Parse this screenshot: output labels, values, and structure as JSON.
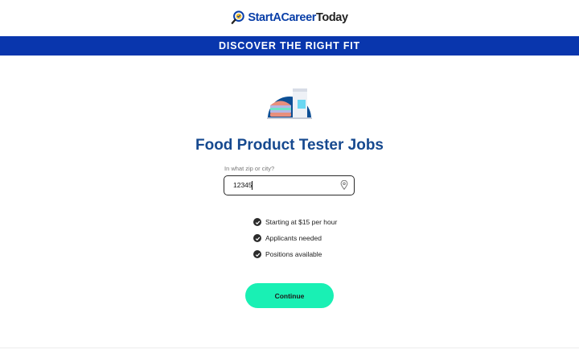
{
  "header": {
    "logo_part1": "StartACareer",
    "logo_part2": "Today",
    "logo_icon": "magnifier-logo-icon"
  },
  "banner": {
    "text": "DISCOVER THE RIGHT FIT"
  },
  "hero": {
    "icon": "burger-drink-icon"
  },
  "title": "Food Product Tester Jobs",
  "location": {
    "label": "In what zip or city?",
    "value": "12345",
    "icon": "map-pin-icon"
  },
  "benefits": [
    "Starting at $15 per hour",
    "Applicants needed",
    "Positions available"
  ],
  "continue_label": "Continue",
  "colors": {
    "brand_blue": "#0936ad",
    "title_blue": "#16498f",
    "button_green": "#19f0b4"
  }
}
